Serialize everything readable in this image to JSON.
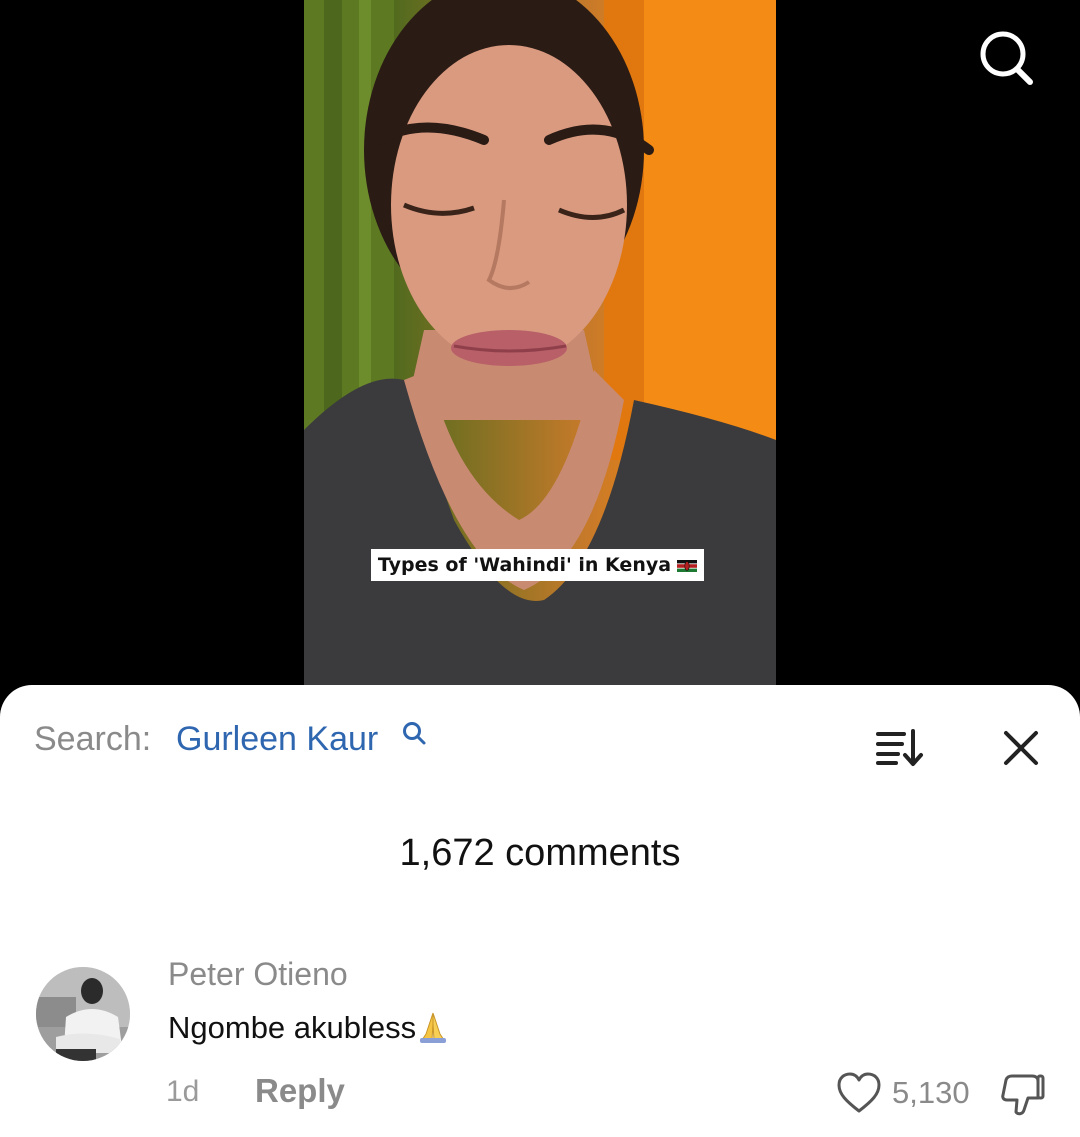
{
  "video": {
    "caption": "Types of 'Wahindi' in Kenya",
    "caption_flag_icon": "kenya-flag-icon",
    "search_icon": "search-icon"
  },
  "comments_panel": {
    "search_label": "Search:",
    "search_query": "Gurleen Kaur",
    "search_query_icon": "search-icon",
    "sort_icon": "sort-icon",
    "close_icon": "close-icon",
    "comment_count": "1,672 comments",
    "accent_color": "#2f66b0",
    "comments": [
      {
        "author": "Peter Otieno",
        "text": "Ngombe akubless",
        "emoji_icon": "folded-hands-icon",
        "age": "1d",
        "reply_label": "Reply",
        "like_icon": "heart-icon",
        "likes": "5,130",
        "dislike_icon": "thumbs-down-icon"
      }
    ]
  }
}
